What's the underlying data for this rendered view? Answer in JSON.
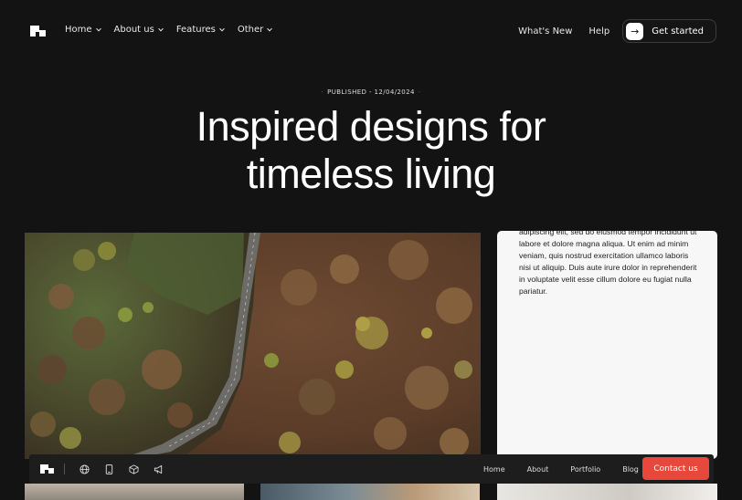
{
  "nav": {
    "menu": [
      {
        "label": "Home"
      },
      {
        "label": "About us"
      },
      {
        "label": "Features"
      },
      {
        "label": "Other"
      }
    ],
    "whats_new": "What's New",
    "help": "Help",
    "cta": "Get started"
  },
  "hero": {
    "published": "PUBLISHED - 12/04/2024",
    "headline_line1": "Inspired designs for",
    "headline_line2": "timeless living"
  },
  "card": {
    "text": "adipiscing elit, sed do eiusmod tempor incididunt ut labore et dolore magna aliqua. Ut enim ad minim veniam, quis nostrud exercitation ullamco laboris nisi ut aliquip. Duis aute irure dolor in reprehenderit in voluptate velit esse cillum dolore eu fugiat nulla pariatur."
  },
  "bottombar": {
    "icons": [
      "globe-icon",
      "tablet-icon",
      "cube-icon",
      "megaphone-icon"
    ],
    "links": [
      "Home",
      "About",
      "Portfolio",
      "Blog"
    ],
    "contact": "Contact us",
    "accent": "#e8473c"
  }
}
